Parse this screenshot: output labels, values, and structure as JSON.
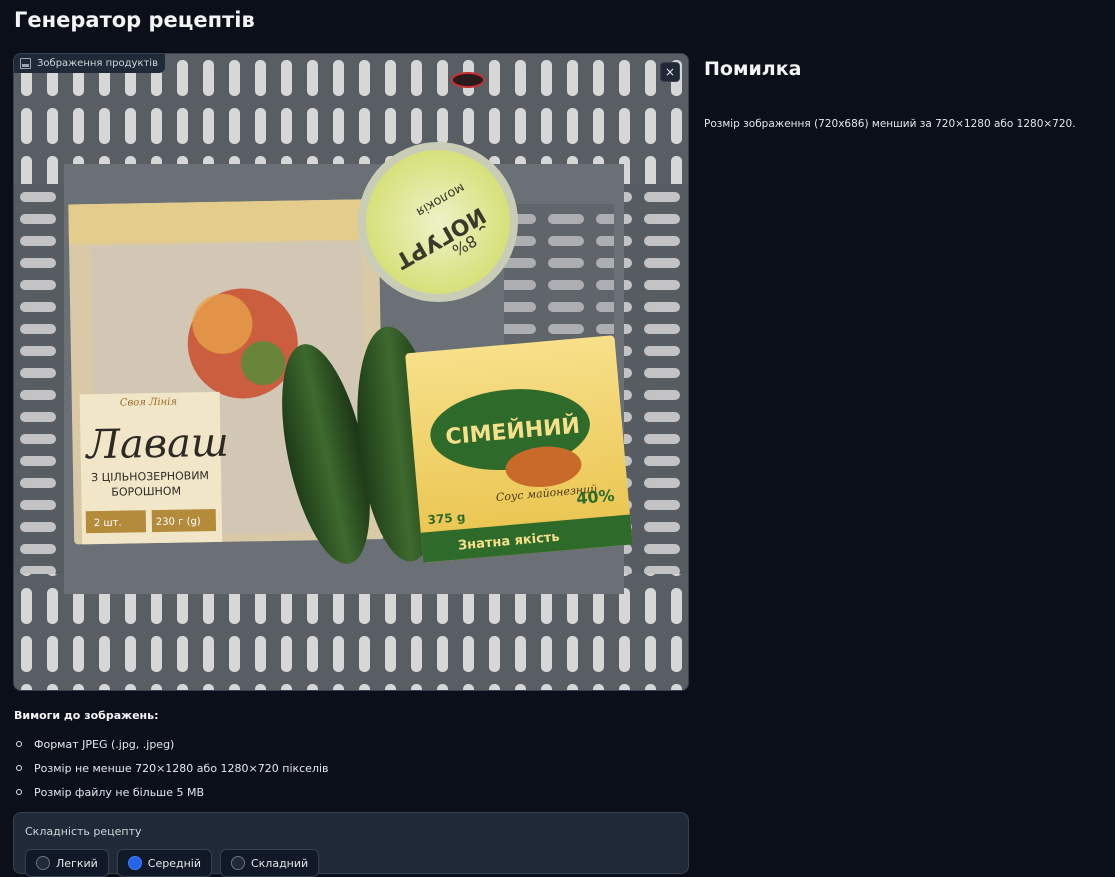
{
  "header": {
    "title": "Генератор рецептів"
  },
  "image_panel": {
    "label": "Зображення продуктів",
    "close_symbol": "×",
    "photo_texts": {
      "lavash": "Лаваш",
      "lavash_sub1": "З ЦІЛЬНОЗЕРНОВИМ",
      "lavash_sub2": "БОРОШНОМ",
      "lavash_qty": "2 шт.",
      "lavash_weight": "230 г (g)",
      "brand_line": "Своя Лінія",
      "yogurt_top": "ЙОГУРТ",
      "yogurt_pct": "8%",
      "yogurt_brand": "молокія",
      "sauce_name": "СІМЕЙНИЙ",
      "sauce_sub": "Соус майонезний",
      "sauce_pct": "40%",
      "sauce_weight": "375 g",
      "sauce_band": "Знатна якість"
    }
  },
  "error": {
    "title": "Помилка",
    "message": "Розмір зображення (720x686) менший за 720×1280 або 1280×720."
  },
  "requirements": {
    "title": "Вимоги до зображень:",
    "items": [
      "Формат JPEG (.jpg, .jpeg)",
      "Розмір не менше 720×1280 або 1280×720 пікселів",
      "Розмір файлу не більше 5 MB"
    ]
  },
  "complexity": {
    "label": "Складність рецепту",
    "options": [
      "Легкий",
      "Середній",
      "Складний"
    ],
    "selected_index": 1
  },
  "colors": {
    "background": "#0b0f19",
    "panel": "#1f2937",
    "accent": "#2563eb"
  }
}
